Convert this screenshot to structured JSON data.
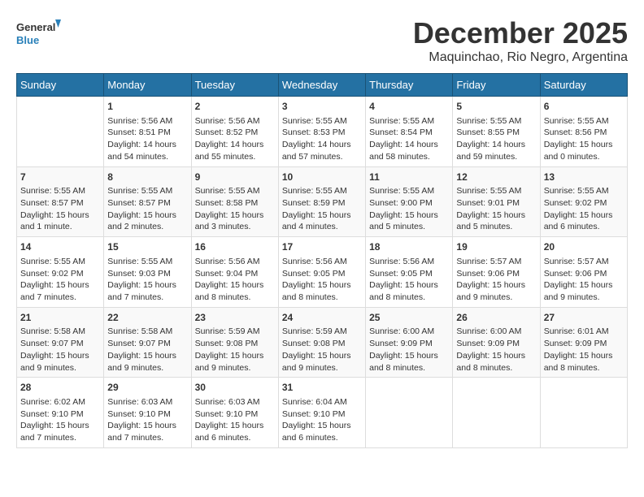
{
  "logo": {
    "line1": "General",
    "line2": "Blue"
  },
  "title": "December 2025",
  "subtitle": "Maquinchao, Rio Negro, Argentina",
  "days_of_week": [
    "Sunday",
    "Monday",
    "Tuesday",
    "Wednesday",
    "Thursday",
    "Friday",
    "Saturday"
  ],
  "weeks": [
    [
      {
        "day": "",
        "content": ""
      },
      {
        "day": "1",
        "content": "Sunrise: 5:56 AM\nSunset: 8:51 PM\nDaylight: 14 hours\nand 54 minutes."
      },
      {
        "day": "2",
        "content": "Sunrise: 5:56 AM\nSunset: 8:52 PM\nDaylight: 14 hours\nand 55 minutes."
      },
      {
        "day": "3",
        "content": "Sunrise: 5:55 AM\nSunset: 8:53 PM\nDaylight: 14 hours\nand 57 minutes."
      },
      {
        "day": "4",
        "content": "Sunrise: 5:55 AM\nSunset: 8:54 PM\nDaylight: 14 hours\nand 58 minutes."
      },
      {
        "day": "5",
        "content": "Sunrise: 5:55 AM\nSunset: 8:55 PM\nDaylight: 14 hours\nand 59 minutes."
      },
      {
        "day": "6",
        "content": "Sunrise: 5:55 AM\nSunset: 8:56 PM\nDaylight: 15 hours\nand 0 minutes."
      }
    ],
    [
      {
        "day": "7",
        "content": "Sunrise: 5:55 AM\nSunset: 8:57 PM\nDaylight: 15 hours\nand 1 minute."
      },
      {
        "day": "8",
        "content": "Sunrise: 5:55 AM\nSunset: 8:57 PM\nDaylight: 15 hours\nand 2 minutes."
      },
      {
        "day": "9",
        "content": "Sunrise: 5:55 AM\nSunset: 8:58 PM\nDaylight: 15 hours\nand 3 minutes."
      },
      {
        "day": "10",
        "content": "Sunrise: 5:55 AM\nSunset: 8:59 PM\nDaylight: 15 hours\nand 4 minutes."
      },
      {
        "day": "11",
        "content": "Sunrise: 5:55 AM\nSunset: 9:00 PM\nDaylight: 15 hours\nand 5 minutes."
      },
      {
        "day": "12",
        "content": "Sunrise: 5:55 AM\nSunset: 9:01 PM\nDaylight: 15 hours\nand 5 minutes."
      },
      {
        "day": "13",
        "content": "Sunrise: 5:55 AM\nSunset: 9:02 PM\nDaylight: 15 hours\nand 6 minutes."
      }
    ],
    [
      {
        "day": "14",
        "content": "Sunrise: 5:55 AM\nSunset: 9:02 PM\nDaylight: 15 hours\nand 7 minutes."
      },
      {
        "day": "15",
        "content": "Sunrise: 5:55 AM\nSunset: 9:03 PM\nDaylight: 15 hours\nand 7 minutes."
      },
      {
        "day": "16",
        "content": "Sunrise: 5:56 AM\nSunset: 9:04 PM\nDaylight: 15 hours\nand 8 minutes."
      },
      {
        "day": "17",
        "content": "Sunrise: 5:56 AM\nSunset: 9:05 PM\nDaylight: 15 hours\nand 8 minutes."
      },
      {
        "day": "18",
        "content": "Sunrise: 5:56 AM\nSunset: 9:05 PM\nDaylight: 15 hours\nand 8 minutes."
      },
      {
        "day": "19",
        "content": "Sunrise: 5:57 AM\nSunset: 9:06 PM\nDaylight: 15 hours\nand 9 minutes."
      },
      {
        "day": "20",
        "content": "Sunrise: 5:57 AM\nSunset: 9:06 PM\nDaylight: 15 hours\nand 9 minutes."
      }
    ],
    [
      {
        "day": "21",
        "content": "Sunrise: 5:58 AM\nSunset: 9:07 PM\nDaylight: 15 hours\nand 9 minutes."
      },
      {
        "day": "22",
        "content": "Sunrise: 5:58 AM\nSunset: 9:07 PM\nDaylight: 15 hours\nand 9 minutes."
      },
      {
        "day": "23",
        "content": "Sunrise: 5:59 AM\nSunset: 9:08 PM\nDaylight: 15 hours\nand 9 minutes."
      },
      {
        "day": "24",
        "content": "Sunrise: 5:59 AM\nSunset: 9:08 PM\nDaylight: 15 hours\nand 9 minutes."
      },
      {
        "day": "25",
        "content": "Sunrise: 6:00 AM\nSunset: 9:09 PM\nDaylight: 15 hours\nand 8 minutes."
      },
      {
        "day": "26",
        "content": "Sunrise: 6:00 AM\nSunset: 9:09 PM\nDaylight: 15 hours\nand 8 minutes."
      },
      {
        "day": "27",
        "content": "Sunrise: 6:01 AM\nSunset: 9:09 PM\nDaylight: 15 hours\nand 8 minutes."
      }
    ],
    [
      {
        "day": "28",
        "content": "Sunrise: 6:02 AM\nSunset: 9:10 PM\nDaylight: 15 hours\nand 7 minutes."
      },
      {
        "day": "29",
        "content": "Sunrise: 6:03 AM\nSunset: 9:10 PM\nDaylight: 15 hours\nand 7 minutes."
      },
      {
        "day": "30",
        "content": "Sunrise: 6:03 AM\nSunset: 9:10 PM\nDaylight: 15 hours\nand 6 minutes."
      },
      {
        "day": "31",
        "content": "Sunrise: 6:04 AM\nSunset: 9:10 PM\nDaylight: 15 hours\nand 6 minutes."
      },
      {
        "day": "",
        "content": ""
      },
      {
        "day": "",
        "content": ""
      },
      {
        "day": "",
        "content": ""
      }
    ]
  ]
}
